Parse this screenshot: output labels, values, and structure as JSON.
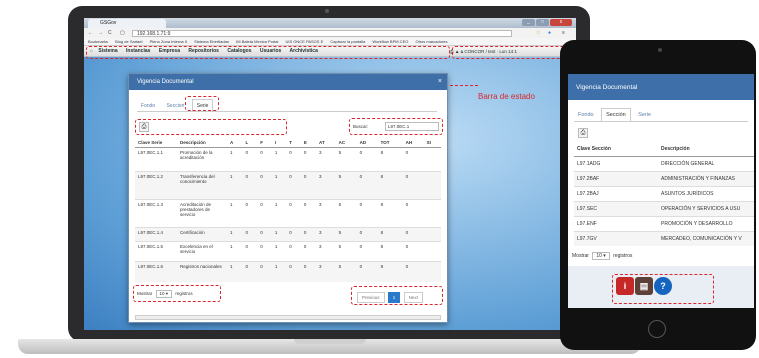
{
  "browser": {
    "tab_title": "GSGov",
    "url": "192.168.1.71:9",
    "bookmarks": [
      "Bookmarks",
      "Blog de Sartael",
      "Pleno Zona Interna II",
      "Sistema Eberfiadan",
      "IM Baleta Mexica Portal",
      "UIS ONCE PASOS E",
      "Capturar la pantalla",
      "Workflow BPM CEO",
      "Otros marcadores"
    ],
    "window_buttons": [
      "_",
      "□",
      "x"
    ]
  },
  "app_menu": {
    "items": [
      "Sistema",
      "Instancias",
      "Empresa",
      "Repositorios",
      "Catalogos",
      "Usuarios",
      "Archivistica"
    ],
    "status_text": "CONCOR / test · Lun 14:1"
  },
  "annotation": {
    "status_bar_label": "Barra de estado"
  },
  "modal": {
    "title": "Vigencia Documental",
    "close": "×",
    "tabs": [
      "Fondo",
      "Seccion",
      "Serie"
    ],
    "active_tab": "Serie",
    "search_label": "Buscar:",
    "search_value": "L97.0EC.1",
    "print_icon": "⎙",
    "columns": [
      "Clave Serie",
      "Descripción",
      "A",
      "L",
      "F",
      "I",
      "T",
      "E",
      "AT",
      "AC",
      "AD",
      "TOT",
      "AH",
      "SI"
    ],
    "rows": [
      [
        "L97.0EC.1.1",
        "Promoción de la acreditación",
        "1",
        "0",
        "0",
        "1",
        "0",
        "0",
        "3",
        "5",
        "0",
        "8",
        "0",
        ""
      ],
      [
        "L97.0EC.1.2",
        "Transferencia del conocimiento",
        "1",
        "0",
        "0",
        "1",
        "0",
        "0",
        "3",
        "5",
        "0",
        "8",
        "0",
        ""
      ],
      [
        "L97.0EC.1.3",
        "Acreditación de prestadores de servicio",
        "1",
        "0",
        "0",
        "1",
        "0",
        "0",
        "3",
        "5",
        "0",
        "8",
        "0",
        ""
      ],
      [
        "L97.0EC.1.4",
        "Certificación",
        "1",
        "0",
        "0",
        "1",
        "0",
        "0",
        "3",
        "5",
        "0",
        "8",
        "0",
        ""
      ],
      [
        "L97.0EC.1.5",
        "Excelencia en el servicio",
        "1",
        "0",
        "0",
        "1",
        "0",
        "0",
        "3",
        "5",
        "0",
        "8",
        "0",
        ""
      ],
      [
        "L97.0EC.1.6",
        "Registros nacionales",
        "1",
        "0",
        "0",
        "1",
        "0",
        "0",
        "3",
        "5",
        "0",
        "8",
        "0",
        ""
      ]
    ],
    "show_label": "Mostrar",
    "page_size": "10",
    "records_label": "registros",
    "pager": {
      "previous": "Previous",
      "current": "1",
      "next": "Next"
    }
  },
  "tablet": {
    "title": "Vigencia Documental",
    "tabs": [
      "Fondo",
      "Sección",
      "Serie"
    ],
    "active_tab": "Sección",
    "print_icon": "⎙",
    "columns": [
      "Clave Sección",
      "Descripción"
    ],
    "rows": [
      [
        "L97.1ADG",
        "DIRECCIÓN GENERAL"
      ],
      [
        "L97.2BAF",
        "ADMINISTRACIÓN Y FINANZAS"
      ],
      [
        "L97.2BAJ",
        "ASUNTOS JURÍDICOS"
      ],
      [
        "L97.SEC",
        "OPERACIÓN Y SERVICIOS A USU"
      ],
      [
        "L97.ENF",
        "PROMOCIÓN Y DESARROLLO"
      ],
      [
        "L97.7GV",
        "MERCADEO, COMUNICACIÓN Y V"
      ]
    ],
    "show_label": "Mostrar",
    "page_size": "10",
    "records_label": "registros"
  },
  "colors": {
    "accent": "#3f6fa8",
    "annotation": "#d9262c",
    "page_active": "#2a7ac9"
  }
}
